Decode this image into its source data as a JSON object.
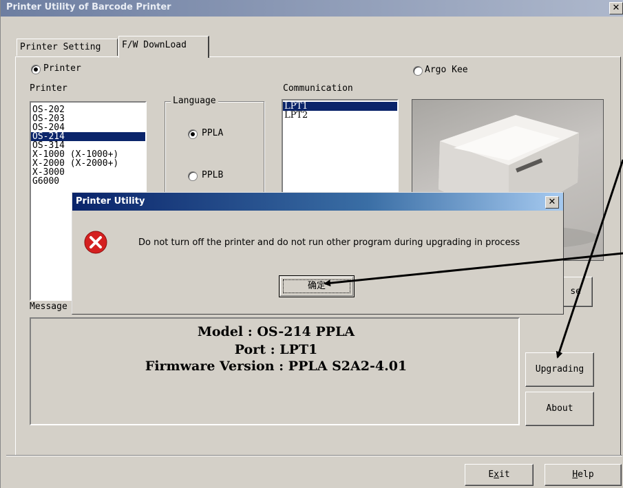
{
  "window": {
    "title": "Printer Utility of Barcode Printer",
    "close_glyph": "✕"
  },
  "tabs": [
    {
      "label": "Printer Setting",
      "active": false
    },
    {
      "label": "F/W DownLoad",
      "active": true
    }
  ],
  "mode": {
    "printer_radio_label": "Printer",
    "argo_radio_label": "Argo Kee",
    "selected": "Printer"
  },
  "printer_list": {
    "label": "Printer",
    "items": [
      "OS-202",
      "OS-203",
      "OS-204",
      "OS-214",
      "OS-314",
      "X-1000  (X-1000+)",
      "X-2000  (X-2000+)",
      "X-3000",
      "G6000"
    ],
    "selected": "OS-214"
  },
  "language": {
    "label": "Language",
    "options": [
      "PPLA",
      "PPLB"
    ],
    "selected": "PPLA"
  },
  "communication": {
    "label": "Communication",
    "items": [
      "LPT1",
      "LPT2"
    ],
    "selected": "LPT1"
  },
  "message": {
    "label": "Message",
    "lines": [
      "Model : OS-214 PPLA",
      "Port : LPT1",
      "Firmware Version : PPLA S2A2-4.01"
    ]
  },
  "buttons": {
    "browse_partial": "se",
    "upgrading": "Upgrading",
    "about": "About",
    "exit": {
      "pre": "E",
      "u": "x",
      "post": "it"
    },
    "help": {
      "pre": "",
      "u": "H",
      "post": "elp"
    }
  },
  "dialog": {
    "title": "Printer Utility",
    "icon": "error-icon",
    "message": "Do not turn off the printer and do not run other program during upgrading in process",
    "ok_label": "确定",
    "close_glyph": "✕"
  },
  "colors": {
    "selection": "#0a246a",
    "error": "#d42020",
    "window_bg": "#d4d0c8"
  }
}
